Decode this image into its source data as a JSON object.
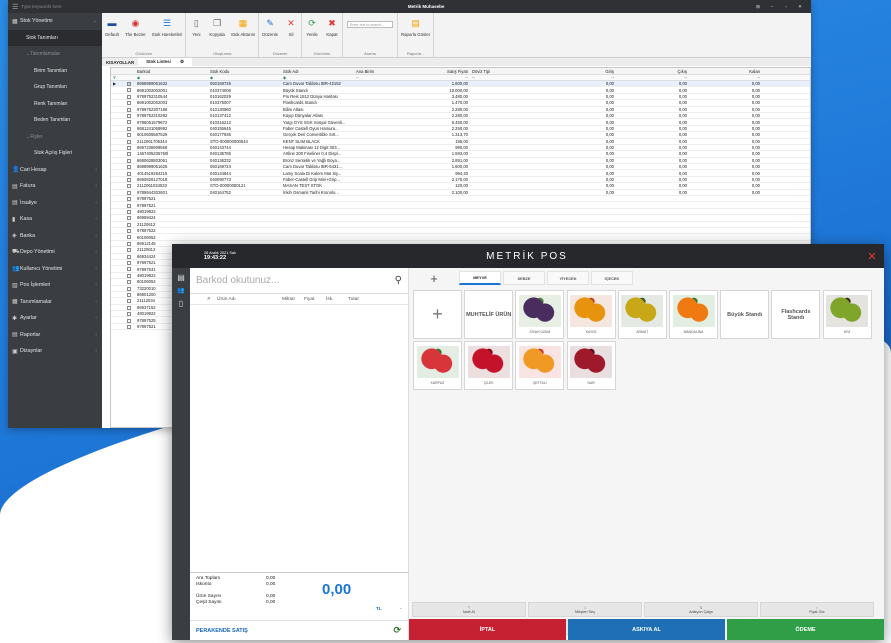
{
  "app": {
    "title": "Metrik Muhasebe",
    "search": "Type keywords here",
    "window_controls": [
      "⊞",
      "–",
      "▫",
      "✕"
    ]
  },
  "sidebar": [
    {
      "label": "Stok Yönetimi",
      "level": 0,
      "icon": "▦",
      "arrow": "⌄"
    },
    {
      "label": "Stok Tanımları",
      "level": 1,
      "selected": true
    },
    {
      "label": "Tanımlamalar",
      "level": 1,
      "muted": true,
      "prefix": "⌄"
    },
    {
      "label": "Birim Tanımları",
      "level": 2
    },
    {
      "label": "Grup Tanımları",
      "level": 2
    },
    {
      "label": "Renk Tanımları",
      "level": 2
    },
    {
      "label": "Beden Tanımları",
      "level": 2
    },
    {
      "label": "Fişler",
      "level": 1,
      "muted": true,
      "prefix": "⌄"
    },
    {
      "label": "Stok Açılış Fişleri",
      "level": 2
    },
    {
      "label": "Cari Hesap",
      "level": 0,
      "icon": "👤",
      "arrow": "‹"
    },
    {
      "label": "Fatura",
      "level": 0,
      "icon": "▤",
      "arrow": "‹"
    },
    {
      "label": "İrsaliye",
      "level": 0,
      "icon": "▤",
      "arrow": "‹"
    },
    {
      "label": "Kasa",
      "level": 0,
      "icon": "▮",
      "arrow": "‹"
    },
    {
      "label": "Banka",
      "level": 0,
      "icon": "◈",
      "arrow": "‹"
    },
    {
      "label": "Depo Yönetimi",
      "level": 0,
      "icon": "⛟",
      "arrow": "‹"
    },
    {
      "label": "Kullanıcı Yönetimi",
      "level": 0,
      "icon": "👥",
      "arrow": "‹"
    },
    {
      "label": "Pos İşlemleri",
      "level": 0,
      "icon": "▧",
      "arrow": "‹"
    },
    {
      "label": "Tanımlamalar",
      "level": 0,
      "icon": "▦",
      "arrow": "‹"
    },
    {
      "label": "Ayarlar",
      "level": 0,
      "icon": "✱",
      "arrow": "‹"
    },
    {
      "label": "Raporlar",
      "level": 0,
      "icon": "▤",
      "arrow": "‹"
    },
    {
      "label": "Dizaynlar",
      "level": 0,
      "icon": "▣",
      "arrow": "‹"
    }
  ],
  "ribbon": {
    "groups": [
      {
        "label": "Görünüm",
        "buttons": [
          {
            "label": "Default",
            "icon": "▬",
            "color": "#1e4f9c"
          },
          {
            "label": "The Bezier",
            "icon": "◉",
            "color": "#d32f2f"
          },
          {
            "label": "Stok Hareketleri",
            "icon": "☰",
            "color": "#1976d2"
          }
        ]
      },
      {
        "label": "Oluşturma",
        "buttons": [
          {
            "label": "Yeni",
            "icon": "▯",
            "color": "#666"
          },
          {
            "label": "Kopyala",
            "icon": "❐",
            "color": "#666"
          },
          {
            "label": "Stok Aktarım",
            "icon": "▦",
            "color": "#f4a300"
          }
        ]
      },
      {
        "label": "Düzenle",
        "buttons": [
          {
            "label": "Düzenle",
            "icon": "✎",
            "color": "#1976d2"
          },
          {
            "label": "Sil",
            "icon": "✕",
            "color": "#e53935"
          }
        ]
      },
      {
        "label": "Görünüm",
        "buttons": [
          {
            "label": "Yenile",
            "icon": "⟳",
            "color": "#2e9e4a"
          },
          {
            "label": "Kapat",
            "icon": "✖",
            "color": "#e53935"
          }
        ]
      },
      {
        "label": "Arama",
        "search_placeholder": "Enter text to search..."
      },
      {
        "label": "Raporla...",
        "buttons": [
          {
            "label": "Raporla Göster",
            "icon": "▤",
            "color": "#f4a300"
          }
        ]
      }
    ]
  },
  "tabs": {
    "kisayol": "KISAYOLLAR",
    "active": "Stok Listesi",
    "close": "⚙"
  },
  "grid": {
    "columns": [
      "",
      "",
      "Barkod",
      "Stok Kodu",
      "Stok Adı",
      "Ana Birim",
      "Satış Fiyatı",
      "Döviz Tipi",
      "Giriş",
      "Çıkış",
      "Kalan"
    ],
    "filter_row": [
      "⊽",
      "",
      "◆",
      "◆",
      "◆",
      "--",
      "--",
      "--",
      "--",
      "--",
      "--"
    ],
    "rows": [
      [
        "8698999061632",
        "050169725",
        "Cam Duvar Tablosu IBR-42152",
        "",
        "1.600,00",
        "",
        "0,00",
        "0,00",
        "0,00"
      ],
      [
        "8691002002001",
        "010374006",
        "Büyük Standı",
        "",
        "10.000,00",
        "",
        "0,00",
        "0,00",
        "0,00"
      ],
      [
        "9789752310544",
        "010162029",
        "Pin Reis 1512 Dünya Haritası",
        "",
        "3.480,00",
        "",
        "0,00",
        "0,00",
        "0,00"
      ],
      [
        "8691002002003",
        "010375007",
        "Flashcards Standı",
        "",
        "1.470,00",
        "",
        "0,00",
        "0,00",
        "0,00"
      ],
      [
        "9789752307186",
        "010130960",
        "Bilim Atlası",
        "",
        "2.280,00",
        "",
        "0,00",
        "0,00",
        "0,00"
      ],
      [
        "9789752310292",
        "010137412",
        "Kayıp Dünyalar Atlası",
        "",
        "2.280,00",
        "",
        "0,00",
        "0,00",
        "0,00"
      ],
      [
        "9786051579672",
        "010316212",
        "Yargı GYS SGK Sosyal Güvenli...",
        "",
        "6.450,00",
        "",
        "0,00",
        "0,00",
        "0,00"
      ],
      [
        "8681241059992",
        "040155645",
        "Faber Castell Oyun Hamuru...",
        "",
        "2.250,00",
        "",
        "0,00",
        "0,00",
        "0,00"
      ],
      [
        "6010605567529",
        "040177936",
        "Gerçek Deri Convertible Sırt...",
        "",
        "1.313,70",
        "",
        "0,00",
        "0,00",
        "0,00"
      ],
      [
        "2112061705344",
        "STO-000000000544",
        "KENT SLIM BLACK",
        "",
        "195,00",
        "",
        "0,00",
        "0,00",
        "0,00"
      ],
      [
        "8697236908558",
        "040143744",
        "Hesap Makinası 12 Digit 303...",
        "",
        "990,00",
        "",
        "0,00",
        "0,00",
        "0,00"
      ],
      [
        "1467405205760l",
        "040136785",
        "Artline 200 Fineliner 0,4 Displ...",
        "",
        "1.593,00",
        "",
        "0,00",
        "0,00",
        "0,00"
      ],
      [
        "8680628803061",
        "040136332",
        "Bronz Sentetik ve Yağlı Boya...",
        "",
        "2.891,00",
        "",
        "0,00",
        "0,00",
        "0,00"
      ],
      [
        "8698999061625",
        "050169724",
        "Cam Duvar Tablosu IBR-5431...",
        "",
        "1.600,00",
        "",
        "0,00",
        "0,00",
        "0,00"
      ],
      [
        "4014519284215",
        "040144844",
        "Lamy Scala Di Kalem Mat Siy...",
        "",
        "994,40",
        "",
        "0,00",
        "0,00",
        "0,00"
      ],
      [
        "8690826127018",
        "040090773",
        "Faber-Castell Grip Mini+Grip...",
        "",
        "2.175,00",
        "",
        "0,00",
        "0,00",
        "0,00"
      ],
      [
        "2112061024533",
        "STO-00000000121",
        "MASAN TEST STOK",
        "",
        "120,00",
        "",
        "0,00",
        "0,00",
        "0,00"
      ],
      [
        "9789944302601",
        "040164752",
        "İnkih Osmanlı Tarihi Kronolo...",
        "",
        "2.100,00",
        "",
        "0,00",
        "0,00",
        "0,00"
      ]
    ],
    "partial_barcodes": [
      "97897521",
      "97897521",
      "48019922",
      "86959424",
      "21120612",
      "97897522",
      "60106052",
      "86912145",
      "21120612",
      "86934424",
      "97897521",
      "97897531",
      "48019922",
      "60106052",
      "73220010",
      "86901200",
      "21112034",
      "86937152",
      "48019922",
      "97897525",
      "97897521"
    ]
  },
  "pos": {
    "title": "METRİK POS",
    "date": "28 Aralık 2021 Salı",
    "time": "19:43:22",
    "close": "✕",
    "barcode_placeholder": "Barkod okutunuz...",
    "cart_columns": [
      "#",
      "Ürün Adı",
      "Miktar",
      "Fiyat",
      "İsk.",
      "Tutar"
    ],
    "categories": [
      "MEYVE",
      "SEBZE",
      "YİYECEK",
      "İÇECEK"
    ],
    "active_category": "MEYVE",
    "tiles": [
      {
        "label": "+",
        "type": "add"
      },
      {
        "label": "MUHTELİF ÜRÜN",
        "type": "text"
      },
      {
        "label": "SİYAH ÜZÜM",
        "color": "#4a2c5e",
        "accent": "#4e8a3a"
      },
      {
        "label": "KAYISI",
        "color": "#e8930d",
        "accent": "#b8451a"
      },
      {
        "label": "ARMUT",
        "color": "#c9a818",
        "accent": "#3d5a2a"
      },
      {
        "label": "MANDALİNA",
        "color": "#f07a12",
        "accent": "#2f7f2f"
      },
      {
        "label": "Büyük Standı",
        "type": "text"
      },
      {
        "label": "Flashcards Standı",
        "type": "text"
      },
      {
        "label": "KİVİ",
        "color": "#7fa52a",
        "accent": "#3e2c18"
      },
      {
        "label": "KARPUZ",
        "color": "#d8353a",
        "accent": "#2e7a2e"
      },
      {
        "label": "ÇİLEK",
        "color": "#c4122a",
        "accent": "#7a0b18"
      },
      {
        "label": "ŞEFTALİ",
        "color": "#f09a25",
        "accent": "#c8372c"
      },
      {
        "label": "NAR",
        "color": "#9e1a2a",
        "accent": "#5a0d16"
      }
    ],
    "summary": {
      "ara_toplam_label": "Ara Toplam",
      "ara_toplam": "0,00",
      "iskonto_label": "Iskonto",
      "iskonto": "0,00",
      "urun_sayisi_label": "Ürün Sayısı",
      "urun_sayisi": "0,00",
      "cesit_sayisi_label": "Çeşit Sayısı",
      "cesit_sayisi": "0,00",
      "total": "0,00",
      "currency": "TL",
      "dash": "-"
    },
    "mode": "PERAKENDE SATIŞ",
    "actions": [
      {
        "label": "İade Al",
        "icon": "↰"
      },
      {
        "label": "Müşteri Seç",
        "icon": "☺"
      },
      {
        "label": "Adisyon Çağır",
        "icon": "⇅"
      },
      {
        "label": "Fiyat Gör",
        "icon": "⌕"
      },
      {
        "label": "Ceyl Elde",
        "icon": "▲"
      },
      {
        "label": "Masa Seç",
        "icon": "▭"
      }
    ],
    "pay": [
      {
        "label": "İPTAL",
        "color": "#c62033"
      },
      {
        "label": "ASKIYA AL",
        "color": "#1e6fb5"
      },
      {
        "label": "ÖDEME",
        "color": "#2f9e46"
      }
    ]
  }
}
